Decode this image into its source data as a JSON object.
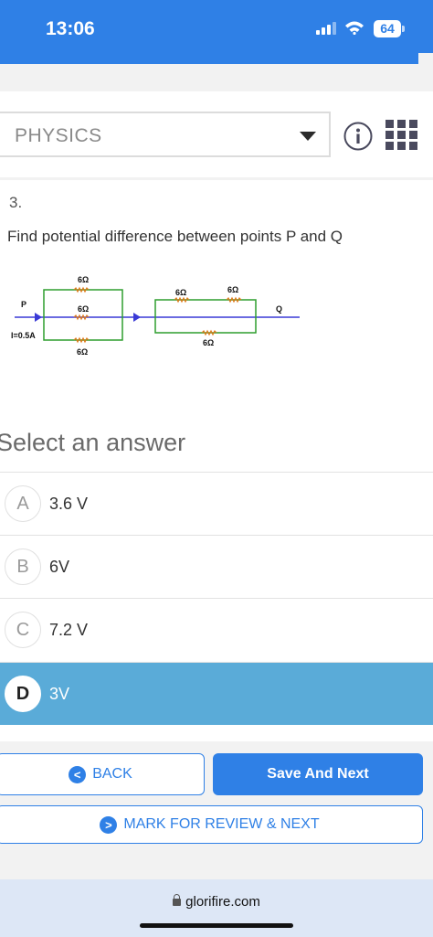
{
  "status_bar": {
    "time": "13:06",
    "battery": "64"
  },
  "subject": {
    "label": "PHYSICS"
  },
  "question": {
    "number": "3.",
    "text": "Find potential difference between points  P and Q",
    "circuit": {
      "point_p": "P",
      "point_q": "Q",
      "current": "I=0.5A",
      "r1_top": "6Ω",
      "r1_mid": "6Ω",
      "r1_bottom": "6Ω",
      "r2_top_left": "6Ω",
      "r2_top_right": "6Ω",
      "r2_bottom": "6Ω"
    }
  },
  "answers": {
    "heading": "Select an answer",
    "options": [
      {
        "letter": "A",
        "text": "3.6 V"
      },
      {
        "letter": "B",
        "text": "6V"
      },
      {
        "letter": "C",
        "text": "7.2 V"
      },
      {
        "letter": "D",
        "text": "3V"
      }
    ],
    "selected": "D"
  },
  "buttons": {
    "back": "BACK",
    "save_next": "Save And Next",
    "mark_review": "MARK FOR REVIEW & NEXT"
  },
  "browser": {
    "url": "glorifire.com"
  },
  "colors": {
    "accent": "#2f80e6",
    "selected_option": "#5aabd8",
    "circuit_wire": "#2e9e2e",
    "circuit_axis": "#3a3ad6"
  },
  "icons": [
    "signal-icon",
    "wifi-icon",
    "battery-icon",
    "dropdown-caret-icon",
    "info-icon",
    "grid-menu-icon",
    "back-arrow-icon",
    "next-arrow-icon",
    "lock-icon"
  ]
}
